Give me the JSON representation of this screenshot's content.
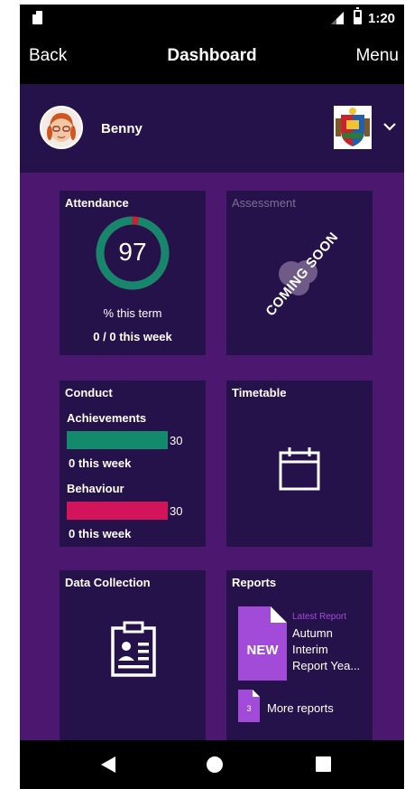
{
  "status_bar": {
    "time": "1:20",
    "icons": [
      "sim-card-icon",
      "signal-icon",
      "battery-icon"
    ]
  },
  "app_bar": {
    "back_label": "Back",
    "title": "Dashboard",
    "menu_label": "Menu"
  },
  "profile": {
    "name": "Benny",
    "icons": [
      "avatar",
      "school-crest-icon",
      "chevron-down-icon"
    ]
  },
  "tiles": {
    "attendance": {
      "title": "Attendance",
      "percent": "97",
      "percent_value": 0.97,
      "term_label": "% this term",
      "week_label": "0 / 0 this week"
    },
    "assessment": {
      "title": "Assessment",
      "overlay": "COMING SOON"
    },
    "conduct": {
      "title": "Conduct",
      "achievements_label": "Achievements",
      "achievements_count": "30",
      "achievements_week": "0 this week",
      "behaviour_label": "Behaviour",
      "behaviour_count": "30",
      "behaviour_week": "0 this week"
    },
    "timetable": {
      "title": "Timetable",
      "icon": "calendar-icon"
    },
    "data_collection": {
      "title": "Data Collection",
      "icon": "clipboard-icon"
    },
    "reports": {
      "title": "Reports",
      "badge": "NEW",
      "latest_label": "Latest Report",
      "latest_lines": [
        "Autumn",
        "Interim",
        "Report Yea..."
      ],
      "more_count": "3",
      "more_label": "More reports"
    }
  },
  "colors": {
    "page_background": "#4b176f",
    "tile_background": "#26124a",
    "attendance_ring": "#16866c",
    "attendance_ring_missing": "#d11f2f",
    "achievements_bar": "#148a6c",
    "behaviour_bar": "#d4145a",
    "report_accent": "#a24bd9"
  },
  "nav_bar": {
    "icons": [
      "back-triangle-icon",
      "home-circle-icon",
      "recents-square-icon"
    ]
  }
}
